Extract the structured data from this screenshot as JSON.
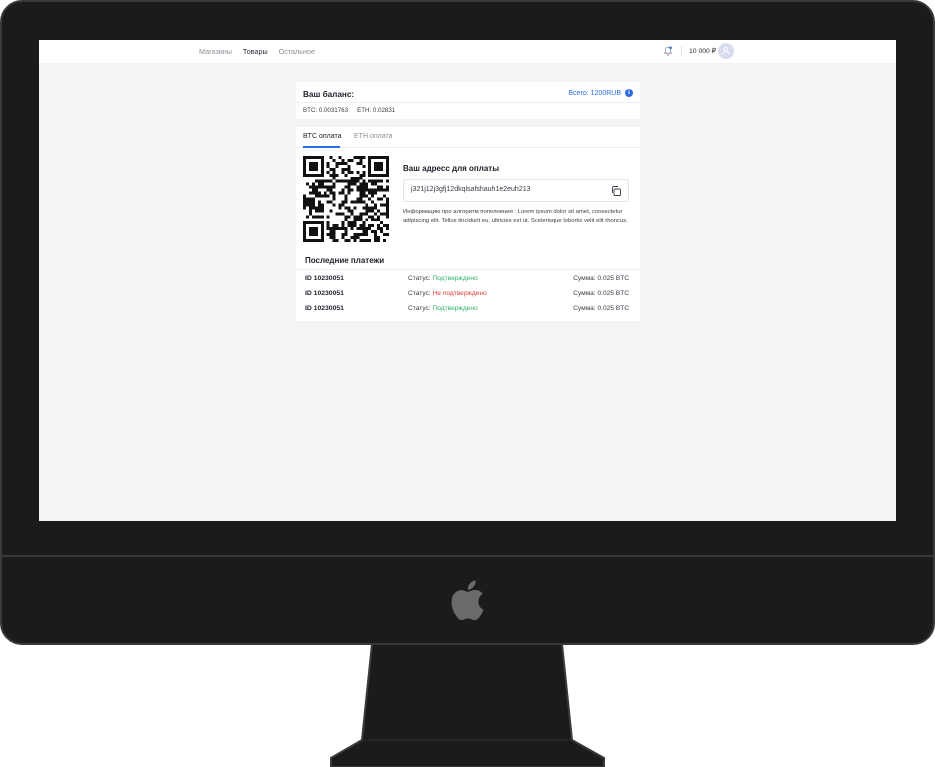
{
  "nav": {
    "items": [
      {
        "label": "Магазины",
        "active": false
      },
      {
        "label": "Товары",
        "active": true
      },
      {
        "label": "Остальное",
        "active": false
      }
    ]
  },
  "header": {
    "balance": "10 000 ₽",
    "bell_icon": "bell-icon",
    "avatar_icon": "user-icon"
  },
  "balance_card": {
    "title": "Ваш баланс:",
    "total": "Всего: 1200RUB",
    "info_icon": "info-icon",
    "btc": "BTC: 0.0031763",
    "eth": "ETH: 0.02831"
  },
  "tabs": [
    {
      "label": "BTC оплата",
      "active": true
    },
    {
      "label": "ETH оплата",
      "active": false
    }
  ],
  "payment": {
    "address_title": "Ваш адресс для оплаты",
    "address": "j321j12j3gfj12dkqlsafshauh1e2euh213",
    "copy_icon": "copy-icon",
    "info_text": "Информацию про алгоритм пополнения : Lorem ipsum dolor sit amet, consectetur adipiscing elit. Tellus tincidunt eu, ultricies est ut. Scelerisque lobortis velit elit rhoncus."
  },
  "recent": {
    "title": "Последние платежи",
    "status_label": "Статус:",
    "rows": [
      {
        "id": "ID 10230051",
        "status": "Подтверждено",
        "state": "ok",
        "sum": "Сумма: 0.025 BTC"
      },
      {
        "id": "ID 10230051",
        "status": "Не подтверждено",
        "state": "bad",
        "sum": "Сумма: 0.025 BTC"
      },
      {
        "id": "ID 10230051",
        "status": "Подтверждено",
        "state": "ok",
        "sum": "Сумма: 0.025 BTC"
      }
    ]
  },
  "colors": {
    "accent": "#2d6be4",
    "confirmed": "#2eb46b",
    "unconfirmed": "#e0403b",
    "bezel": "#1b1b1b"
  }
}
